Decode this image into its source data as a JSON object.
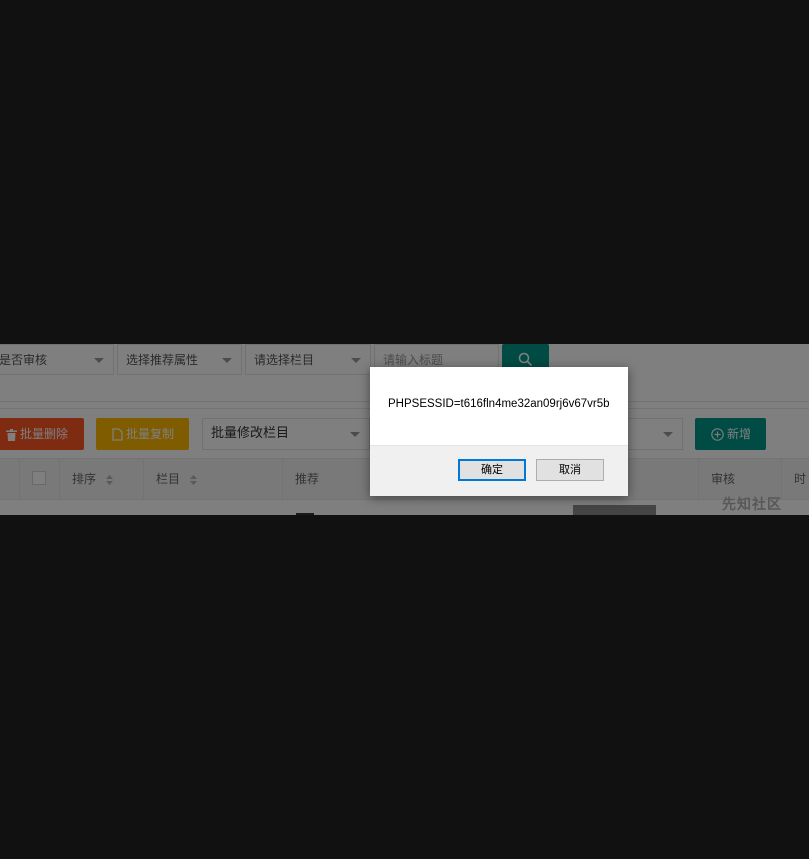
{
  "filters": {
    "audit_select": "是否审核",
    "recommend_select": "选择推荐属性",
    "column_select": "请选择栏目",
    "title_input_placeholder": "请输入标题"
  },
  "toolbar": {
    "batch_delete": "批量删除",
    "batch_copy": "批量复制",
    "batch_modify_column": "批量修改栏目",
    "add_new": "新增"
  },
  "table": {
    "headers": [
      "排序",
      "栏目",
      "推荐",
      "审核",
      "时"
    ]
  },
  "watermark": "先知社区",
  "dialog": {
    "message": "PHPSESSID=t616fln4me32an09rj6v67vr5b",
    "ok_label": "确定",
    "cancel_label": "取消"
  },
  "colors": {
    "danger": "#FF5722",
    "warning": "#FFB800",
    "primary": "#009688",
    "dialog_focus": "#0078d7"
  }
}
